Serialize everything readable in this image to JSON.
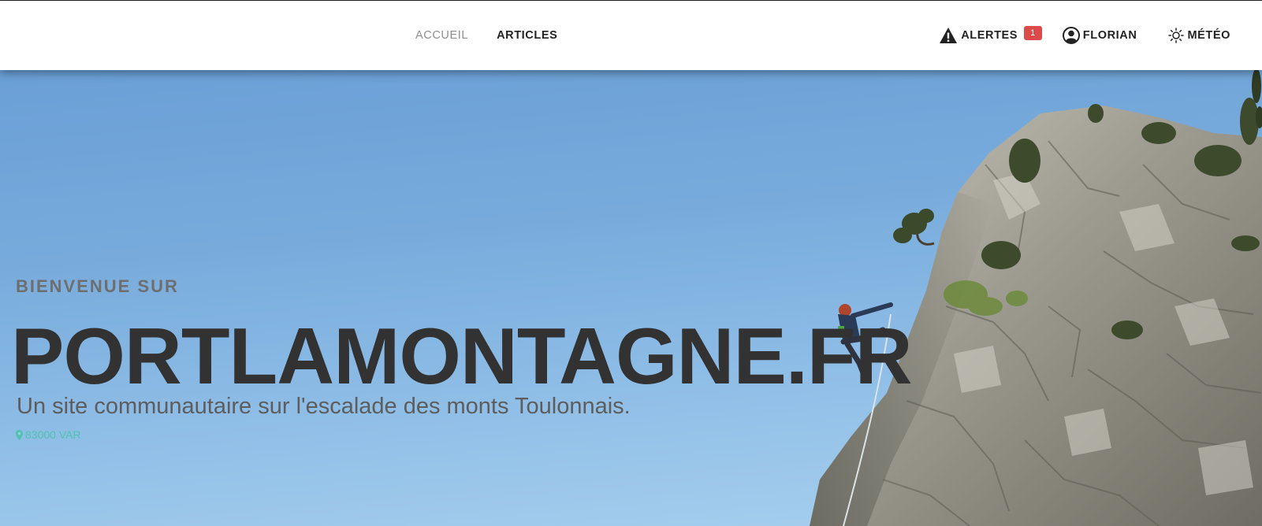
{
  "nav": {
    "home": "ACCUEIL",
    "articles": "ARTICLES",
    "alerts": "ALERTES",
    "alerts_count": "1",
    "user": "FLORIAN",
    "weather": "MÉTÉO"
  },
  "hero": {
    "kicker": "BIENVENUE SUR",
    "title": "PORTLAMONTAGNE.FR",
    "subtitle": "Un site communautaire sur l'escalade des monts Toulonnais.",
    "location": "83000 VAR"
  },
  "colors": {
    "badge": "#dc4a4a",
    "location_accent": "#4fc3b0",
    "sky": "#78abdc"
  },
  "icons": {
    "alerts": "warning-icon",
    "user": "user-circle-icon",
    "weather": "sun-icon",
    "location": "map-pin-icon"
  }
}
